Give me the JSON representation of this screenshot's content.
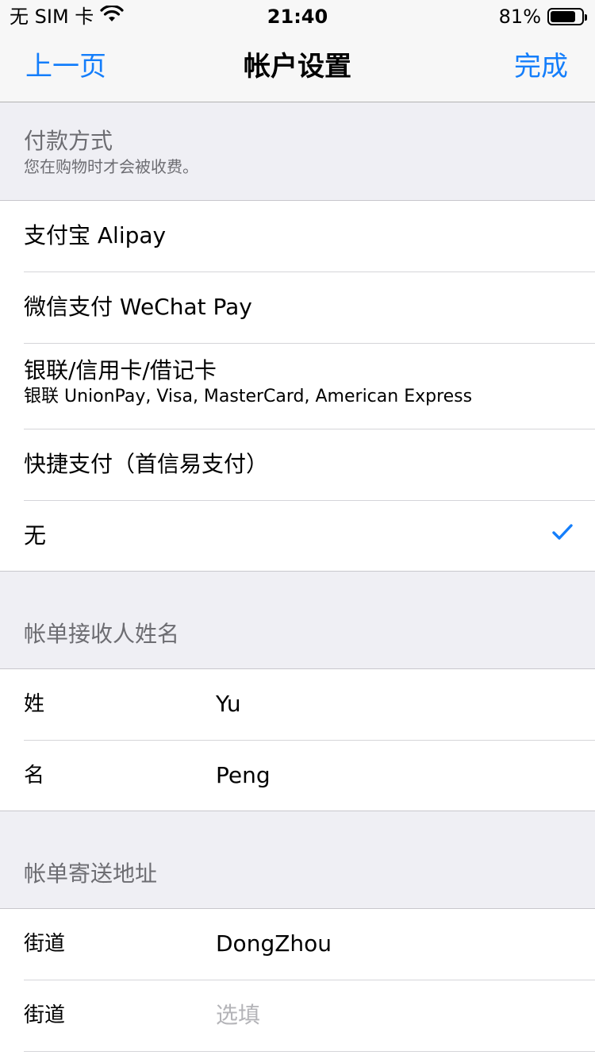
{
  "status_bar": {
    "carrier": "无 SIM 卡",
    "time": "21:40",
    "battery": "81%",
    "battery_level": 0.81,
    "wifi_icon": "wifi-icon",
    "battery_icon": "battery-icon"
  },
  "nav": {
    "back": "上一页",
    "title": "帐户设置",
    "done": "完成"
  },
  "payment": {
    "title": "付款方式",
    "subtitle": "您在购物时才会被收费。",
    "options": [
      {
        "label": "支付宝 Alipay"
      },
      {
        "label": "微信支付 WeChat Pay"
      },
      {
        "label": "银联/信用卡/借记卡",
        "sub": "银联 UnionPay, Visa, MasterCard, American Express"
      },
      {
        "label": "快捷支付（首信易支付）"
      },
      {
        "label": "无",
        "selected": true
      }
    ],
    "check_color": "#147efb"
  },
  "billing_name": {
    "title": "帐单接收人姓名",
    "fields": [
      {
        "label": "姓",
        "value": "Yu"
      },
      {
        "label": "名",
        "value": "Peng"
      }
    ]
  },
  "billing_address": {
    "title": "帐单寄送地址",
    "fields": [
      {
        "label": "街道",
        "value": "DongZhou"
      },
      {
        "label": "街道",
        "placeholder": "选填"
      }
    ]
  },
  "colors": {
    "accent": "#147efb",
    "background": "#efeff4",
    "placeholder": "#b4b4b8"
  }
}
